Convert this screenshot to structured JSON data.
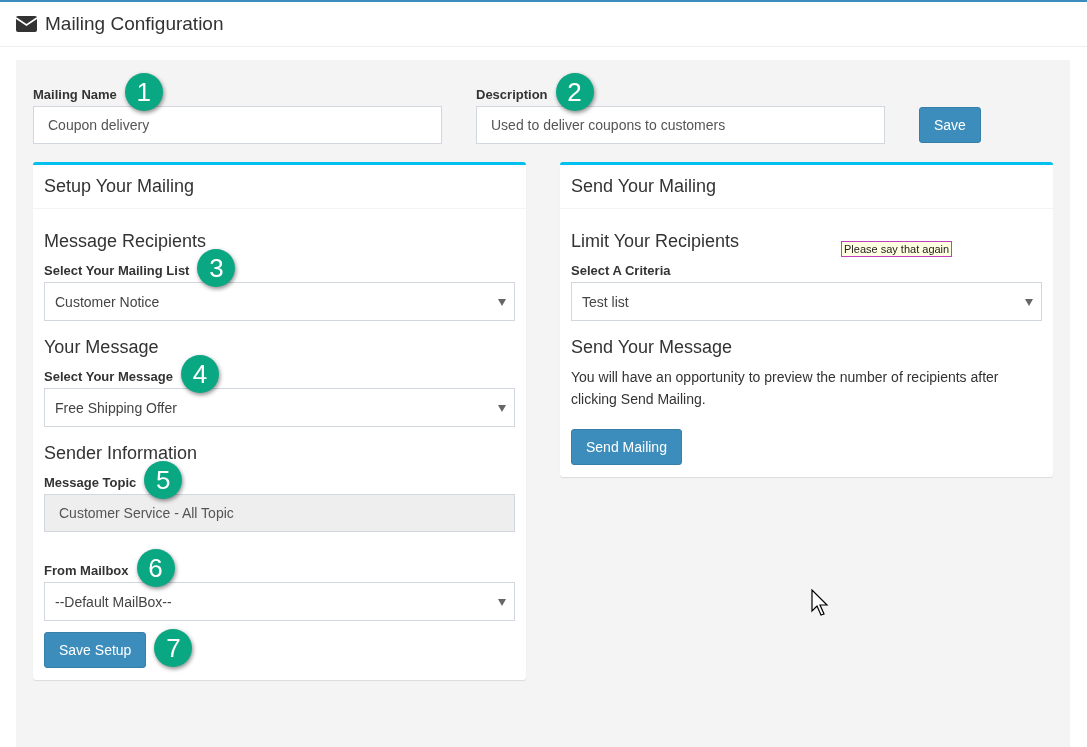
{
  "header": {
    "title": "Mailing Configuration"
  },
  "mailing_name": {
    "label": "Mailing Name",
    "value": "Coupon delivery",
    "callout": "1"
  },
  "description": {
    "label": "Description",
    "value": "Used to deliver coupons to customers",
    "callout": "2"
  },
  "save_button": "Save",
  "setup_panel": {
    "title": "Setup Your Mailing",
    "sections": [
      {
        "heading": "Message Recipients",
        "fields": [
          {
            "kind": "select",
            "label": "Select Your Mailing List",
            "value": "Customer Notice",
            "callout": "3"
          }
        ]
      },
      {
        "heading": "Your Message",
        "fields": [
          {
            "kind": "select",
            "label": "Select Your Message",
            "value": "Free Shipping Offer",
            "callout": "4"
          }
        ]
      },
      {
        "heading": "Sender Information",
        "fields": [
          {
            "kind": "readonly",
            "label": "Message Topic",
            "value": "Customer Service - All Topic",
            "callout": "5"
          },
          {
            "kind": "select",
            "label": "From Mailbox",
            "value": "--Default MailBox--",
            "callout": "6"
          }
        ]
      }
    ],
    "button": "Save Setup",
    "button_callout": "7"
  },
  "send_panel": {
    "title": "Send Your Mailing",
    "tooltip": "Please say that again",
    "sections": [
      {
        "heading": "Limit Your Recipients",
        "fields": [
          {
            "kind": "select",
            "label": "Select A Criteria",
            "value": "Test list"
          }
        ]
      },
      {
        "heading": "Send Your Message",
        "text": "You will have an opportunity to preview the number of recipients after clicking Send Mailing."
      }
    ],
    "button": "Send Mailing"
  }
}
